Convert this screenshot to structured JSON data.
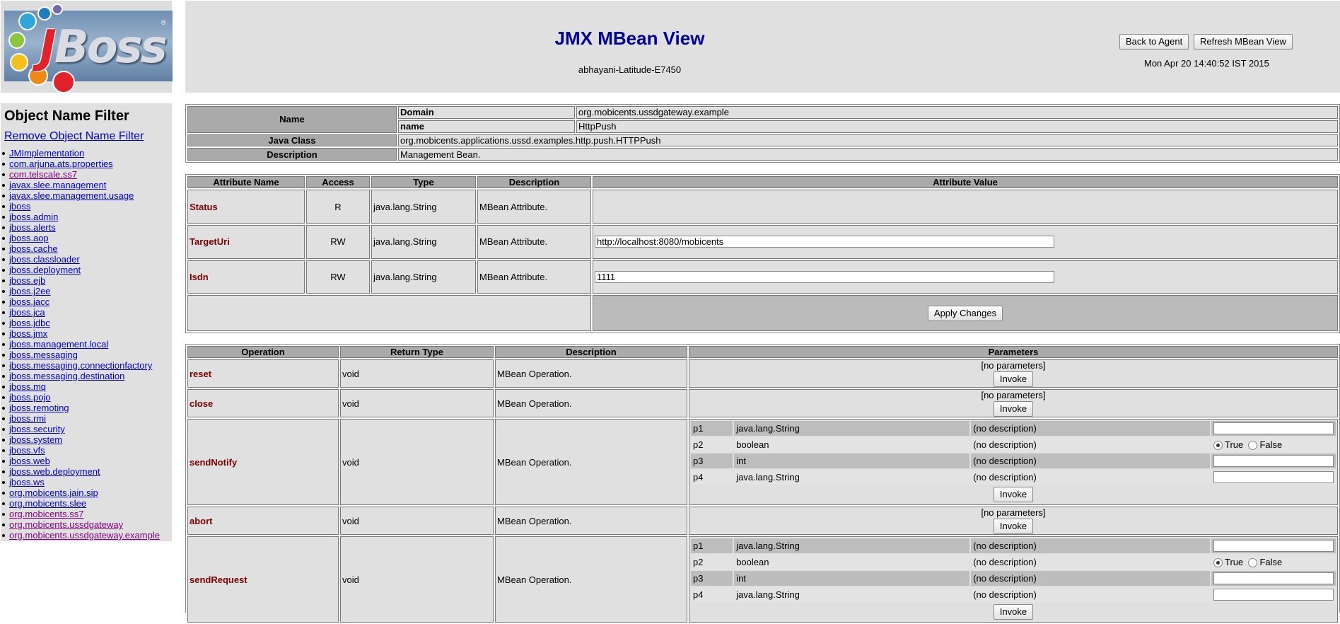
{
  "header": {
    "title": "JMX MBean View",
    "host": "abhayani-Latitude-E7450",
    "back_label": "Back to Agent",
    "refresh_label": "Refresh MBean View",
    "timestamp": "Mon Apr 20 14:40:52 IST 2015"
  },
  "logo": {
    "text_j": "J",
    "text_boss": "Boss",
    "reg": "®"
  },
  "sidebar": {
    "title": "Object Name Filter",
    "remove_label": "Remove Object Name Filter",
    "domains": [
      "JMImplementation",
      "com.arjuna.ats.properties",
      "com.telscale.ss7",
      "javax.slee.management",
      "javax.slee.management.usage",
      "jboss",
      "jboss.admin",
      "jboss.alerts",
      "jboss.aop",
      "jboss.cache",
      "jboss.classloader",
      "jboss.deployment",
      "jboss.ejb",
      "jboss.j2ee",
      "jboss.jacc",
      "jboss.jca",
      "jboss.jdbc",
      "jboss.jmx",
      "jboss.management.local",
      "jboss.messaging",
      "jboss.messaging.connectionfactory",
      "jboss.messaging.destination",
      "jboss.mq",
      "jboss.pojo",
      "jboss.remoting",
      "jboss.rmi",
      "jboss.security",
      "jboss.system",
      "jboss.vfs",
      "jboss.web",
      "jboss.web.deployment",
      "jboss.ws",
      "org.mobicents.jain.sip",
      "org.mobicents.slee",
      "org.mobicents.ss7",
      "org.mobicents.ussdgateway",
      "org.mobicents.ussdgateway.example"
    ]
  },
  "mbean": {
    "name_label": "Name",
    "domain_label": "Domain",
    "domain_value": "org.mobicents.ussdgateway.example",
    "name_key": "name",
    "name_value": "HttpPush",
    "class_label": "Java Class",
    "class_value": "org.mobicents.applications.ussd.examples.http.push.HTTPPush",
    "desc_label": "Description",
    "desc_value": "Management Bean."
  },
  "attributes": {
    "headers": [
      "Attribute Name",
      "Access",
      "Type",
      "Description",
      "Attribute Value"
    ],
    "rows": [
      {
        "name": "Status",
        "access": "R",
        "type": "java.lang.String",
        "desc": "MBean Attribute.",
        "value": ""
      },
      {
        "name": "TargetUri",
        "access": "RW",
        "type": "java.lang.String",
        "desc": "MBean Attribute.",
        "value": "http://localhost:8080/mobicents"
      },
      {
        "name": "Isdn",
        "access": "RW",
        "type": "java.lang.String",
        "desc": "MBean Attribute.",
        "value": "1111"
      }
    ],
    "apply_label": "Apply Changes"
  },
  "operations": {
    "headers": [
      "Operation",
      "Return Type",
      "Description",
      "Parameters"
    ],
    "no_params": "[no parameters]",
    "invoke_label": "Invoke",
    "true_label": "True",
    "false_label": "False",
    "rows": [
      {
        "name": "reset",
        "ret": "void",
        "desc": "MBean Operation."
      },
      {
        "name": "close",
        "ret": "void",
        "desc": "MBean Operation."
      },
      {
        "name": "sendNotify",
        "ret": "void",
        "desc": "MBean Operation.",
        "params": [
          {
            "p": "p1",
            "type": "java.lang.String",
            "desc": "(no description)"
          },
          {
            "p": "p2",
            "type": "boolean",
            "desc": "(no description)"
          },
          {
            "p": "p3",
            "type": "int",
            "desc": "(no description)"
          },
          {
            "p": "p4",
            "type": "java.lang.String",
            "desc": "(no description)"
          }
        ]
      },
      {
        "name": "abort",
        "ret": "void",
        "desc": "MBean Operation."
      },
      {
        "name": "sendRequest",
        "ret": "void",
        "desc": "MBean Operation.",
        "params": [
          {
            "p": "p1",
            "type": "java.lang.String",
            "desc": "(no description)"
          },
          {
            "p": "p2",
            "type": "boolean",
            "desc": "(no description)"
          },
          {
            "p": "p3",
            "type": "int",
            "desc": "(no description)"
          },
          {
            "p": "p4",
            "type": "java.lang.String",
            "desc": "(no description)"
          }
        ]
      }
    ]
  }
}
